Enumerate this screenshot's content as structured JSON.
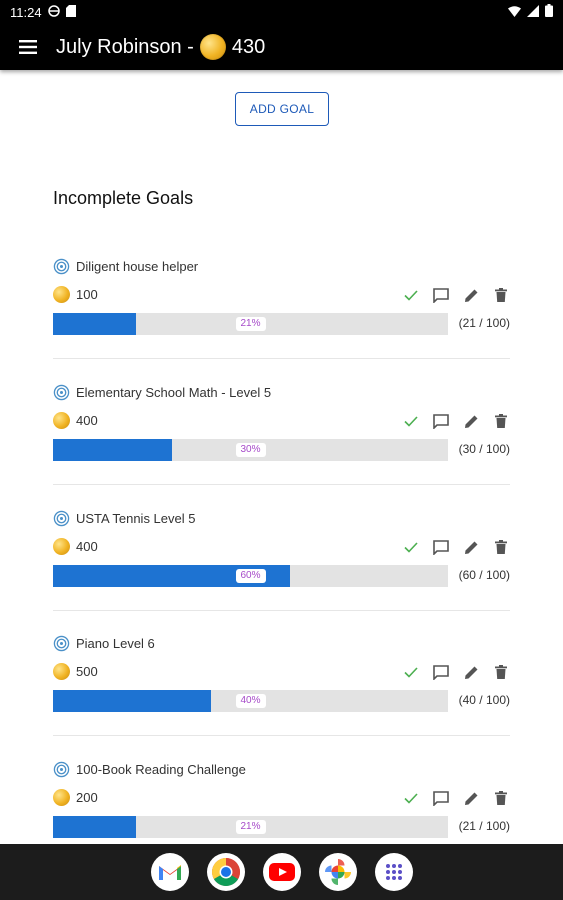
{
  "status_bar": {
    "time": "11:24"
  },
  "app_bar": {
    "user_name": "July Robinson -",
    "coins": "430"
  },
  "add_goal_label": "ADD GOAL",
  "section_title": "Incomplete Goals",
  "goals": [
    {
      "title": "Diligent house helper",
      "reward": "100",
      "progress": 0.21,
      "percent_label": "21%",
      "ratio": "(21 / 100)"
    },
    {
      "title": "Elementary School Math - Level 5",
      "reward": "400",
      "progress": 0.3,
      "percent_label": "30%",
      "ratio": "(30 / 100)"
    },
    {
      "title": "USTA Tennis Level 5",
      "reward": "400",
      "progress": 0.6,
      "percent_label": "60%",
      "ratio": "(60 / 100)"
    },
    {
      "title": "Piano Level 6",
      "reward": "500",
      "progress": 0.4,
      "percent_label": "40%",
      "ratio": "(40 / 100)"
    },
    {
      "title": "100-Book Reading Challenge",
      "reward": "200",
      "progress": 0.21,
      "percent_label": "21%",
      "ratio": "(21 / 100)"
    }
  ],
  "colors": {
    "accent": "#1e73d2",
    "button_border": "#1e5ab8",
    "percent_text": "#a64ac9",
    "check": "#4caf50"
  },
  "dock_apps": [
    "gmail-icon",
    "chrome-icon",
    "youtube-icon",
    "photos-icon",
    "app-drawer-icon"
  ]
}
